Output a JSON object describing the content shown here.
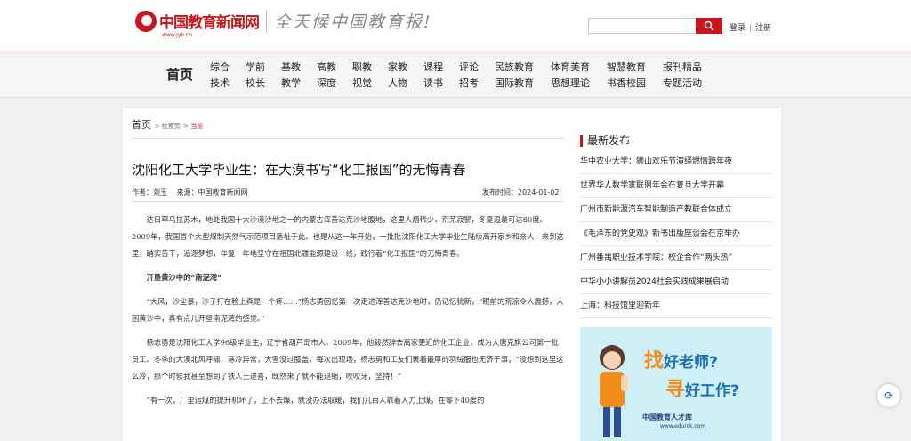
{
  "header": {
    "logo_text": "中国教育新闻网",
    "logo_url": "www.jyb.cn",
    "slogan": "全天候中国教育报!",
    "search_placeholder": "",
    "login": "登录",
    "register": "注册"
  },
  "nav": {
    "home": "首页",
    "items": [
      [
        "综合",
        "技术"
      ],
      [
        "学前",
        "校长"
      ],
      [
        "基教",
        "教学"
      ],
      [
        "高教",
        "深度"
      ],
      [
        "职教",
        "视觉"
      ],
      [
        "家教",
        "人物"
      ],
      [
        "课程",
        "读书"
      ],
      [
        "评论",
        "招考"
      ],
      [
        "民族教育",
        "国际教育"
      ],
      [
        "体育美育",
        "思想理论"
      ],
      [
        "智慧教育",
        "书香校园"
      ],
      [
        "报刊精品",
        "专题活动"
      ]
    ]
  },
  "breadcrumb": {
    "home": "首页",
    "search": "检索页",
    "current": "当前"
  },
  "article": {
    "title": "沈阳化工大学毕业生：在大漠书写“化工报国”的无悔青春",
    "author": "作者：刘玉",
    "source": "来源：中国教育新闻网",
    "date": "发布时间：2024-01-02",
    "p1": "达日罕乌拉苏木，地处我国十大沙漠沙地之一的内蒙古浑善达克沙地腹地，这里人烟稀少，荒芜寂寥，冬夏温差可达80度。2009年，我国首个大型煤制天然气示范项目落址于此。也是从这一年开始，一批批沈阳化工大学毕业生陆续离开家乡和亲人，来到这里，踏实苦干，追逐梦想，年复一年地坚守在祖国北疆能源建设一线，践行着“化工报国”的无悔青春。",
    "subtitle": "开垦黄沙中的“南泥湾”",
    "p2": "“大风，沙尘暴，沙子打在脸上真是一个疼……”杨志勇回忆第一次走进浑善达克沙地时，仍记忆犹新，“眼前的荒凉令人震撼，人困黄沙中，真有点儿开垦南泥湾的感觉。”",
    "p3": "杨志勇是沈阳化工大学96级毕业生，辽宁省葫芦岛市人。2009年，他毅然辞去离家更近的化工企业，成为大唐克旗公司第一批员工。冬季的大漠北风呼啸，寒冷异常，大雪没过膝盖，每次出现场，杨志勇和工友们裹着最厚的羽绒服也无济于事，“没想到这里这么冷，那个时候我甚至想到了铁人王进喜，既然来了就不能退缩，咬咬牙，坚持！”",
    "p4": "“有一次，厂里运煤的提升机坏了，上不去煤，就没办法取暖，我们几百人靠着人力上煤，在零下40度的"
  },
  "sidebar": {
    "title": "最新发布",
    "items": [
      "华中农业大学：狮山欢乐节演绎燃情跨年夜",
      "世界华人数学家联盟年会在复旦大学开幕",
      "广州市新能源汽车智能制造产教联合体成立",
      "《毛泽东的党史观》新书出版座谈会在京举办",
      "广州番禺职业技术学院：校企合作“两头热”",
      "中华小小讲解员2024社会实践成果展启动",
      "上海：科技馆里迎新年"
    ]
  },
  "ad": {
    "big1": "找",
    "line1": "好老师?",
    "big2": "寻",
    "line2": "好工作?",
    "logo": "中国教育人才库",
    "url": "www.edurck.com"
  },
  "colors": {
    "brand": "#c8161d",
    "ad_blue": "#1a6fb8",
    "ad_orange": "#f08c1a"
  }
}
